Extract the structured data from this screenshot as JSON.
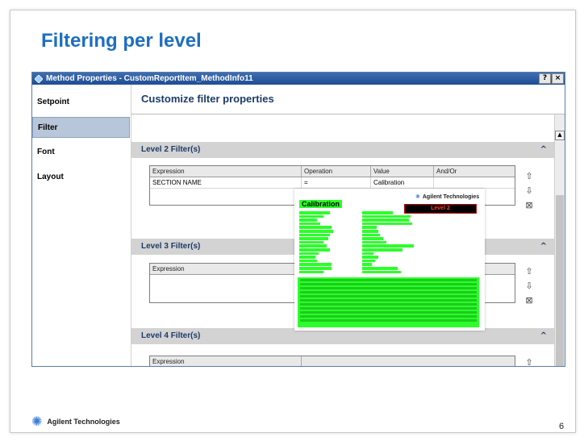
{
  "slide": {
    "title": "Filtering per level",
    "page_number": "6",
    "footer_brand": "Agilent Technologies"
  },
  "dialog": {
    "title": "Method Properties - CustomReportItem_MethodInfo11",
    "help_btn": "?",
    "close_btn": "×",
    "nav": [
      {
        "label": "Setpoint",
        "active": false
      },
      {
        "label": "Filter",
        "active": true
      },
      {
        "label": "Font",
        "active": false
      },
      {
        "label": "Layout",
        "active": false
      }
    ],
    "content_title": "Customize filter properties",
    "sections": [
      {
        "title": "Level 2 Filter(s)",
        "columns": [
          "Expression",
          "Operation",
          "Value",
          "And/Or"
        ],
        "rows": [
          [
            "SECTION NAME",
            "=",
            "Calibration",
            ""
          ]
        ]
      },
      {
        "title": "Level 3 Filter(s)",
        "columns": [
          "Expression"
        ],
        "rows": []
      },
      {
        "title": "Level 4 Filter(s)",
        "columns": [
          "Expression"
        ],
        "rows": []
      }
    ]
  },
  "overlay": {
    "heading": "Calibration",
    "brand": "Agilent Technologies",
    "level_label": "Level 2"
  },
  "colors": {
    "title_blue": "#1d6fc0",
    "highlight_green": "#2bff2b",
    "level_red": "#ff3b3b"
  }
}
